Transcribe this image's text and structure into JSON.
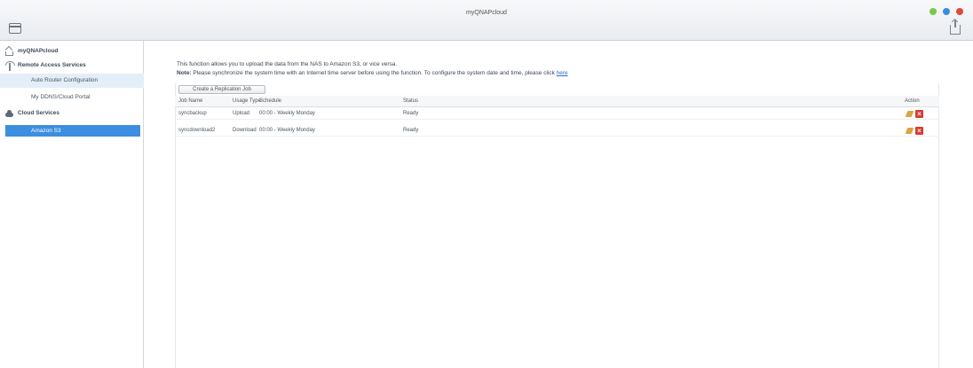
{
  "window": {
    "title": "myQNAPcloud"
  },
  "sidebar": {
    "items": [
      {
        "label": "myQNAPcloud"
      },
      {
        "label": "Remote Access Services"
      },
      {
        "label": "Auto Router Configuration"
      },
      {
        "label": "My DDNS/Cloud Portal"
      },
      {
        "label": "Cloud Services"
      },
      {
        "label": "Amazon S3"
      }
    ]
  },
  "main": {
    "description": "This function allows you to upload the data from the NAS to Amazon S3, or vice versa.",
    "note_label": "Note:",
    "note_text": " Please synchronize the system time with an Internet time server before using the function. To configure the system date and time, please click ",
    "note_link": "here",
    "create_button": "Create a Replication Job",
    "table": {
      "headers": {
        "name": "Job Name",
        "type": "Usage Type",
        "schedule": "Schedule",
        "status": "Status",
        "action": "Action"
      },
      "rows": [
        {
          "name": "syncbackup",
          "type": "Upload",
          "schedule": "00:00 - Weekly Monday",
          "status": "Ready"
        },
        {
          "name": "syncdownload2",
          "type": "Download",
          "schedule": "00:00 - Weekly Monday",
          "status": "Ready"
        }
      ]
    }
  },
  "colors": {
    "accent": "#3d8ee0",
    "delete": "#d93b30",
    "edit": "#d9a441"
  }
}
